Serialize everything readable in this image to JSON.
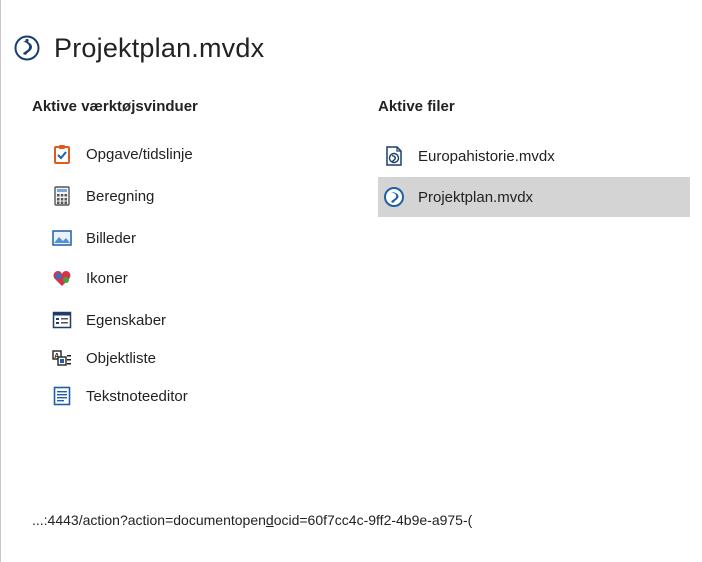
{
  "window": {
    "title": "Projektplan.mvdx"
  },
  "tools": {
    "header": "Aktive værktøjsvinduer",
    "items": [
      {
        "label": "Opgave/tidslinje",
        "icon": "task-timeline-icon"
      },
      {
        "label": "Beregning",
        "icon": "calculator-icon"
      },
      {
        "label": "Billeder",
        "icon": "image-icon"
      },
      {
        "label": "Ikoner",
        "icon": "icons-icon"
      },
      {
        "label": "Egenskaber",
        "icon": "properties-icon"
      },
      {
        "label": "Objektliste",
        "icon": "object-list-icon"
      },
      {
        "label": "Tekstnoteeditor",
        "icon": "text-note-icon"
      }
    ]
  },
  "files": {
    "header": "Aktive filer",
    "items": [
      {
        "label": "Europahistorie.mvdx",
        "icon": "mindview-doc-icon",
        "selected": false
      },
      {
        "label": "Projektplan.mvdx",
        "icon": "mindview-app-icon",
        "selected": true
      }
    ]
  },
  "status": {
    "url_prefix": "...:4443/action?action=documentopen",
    "url_underlined": "d",
    "url_suffix": "ocid=60f7cc4c-9ff2-4b9e-a975-("
  },
  "colors": {
    "selected_bg": "#d4d4d4",
    "app_blue": "#1f5fa8",
    "accent_orange": "#e05a1e"
  }
}
